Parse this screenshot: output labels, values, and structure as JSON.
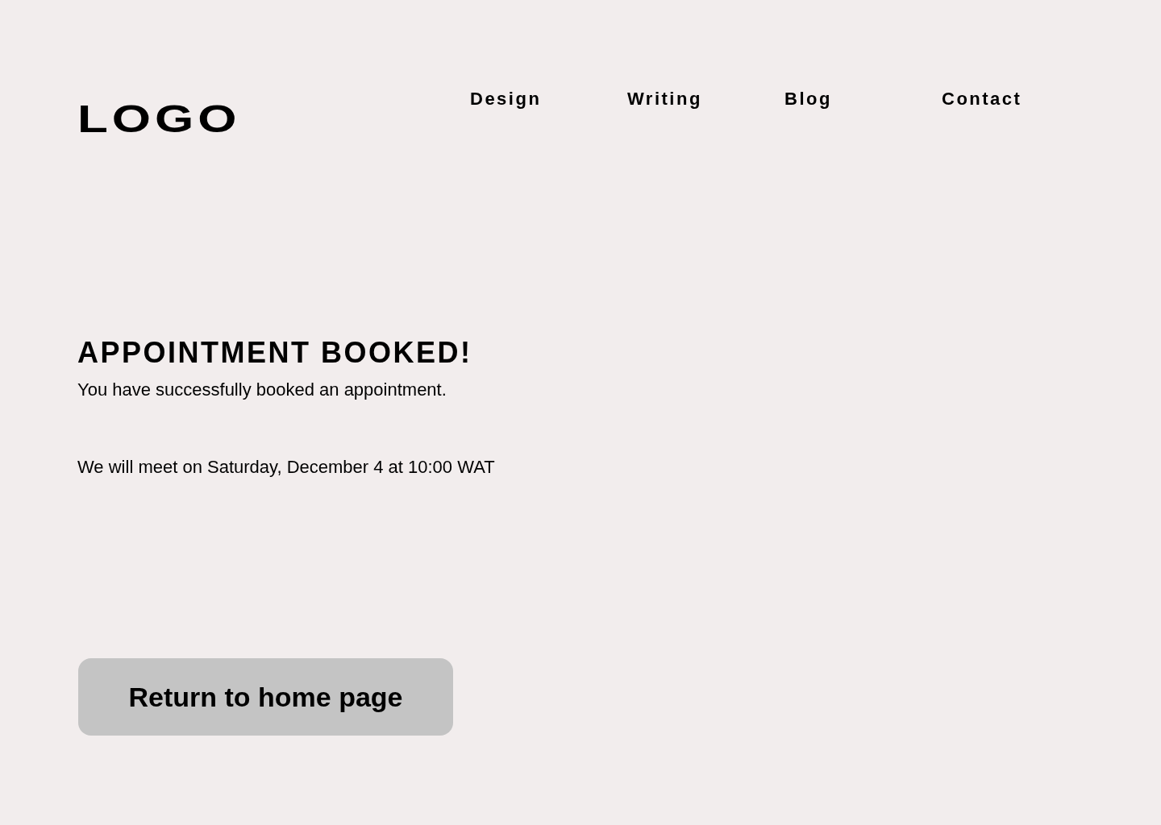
{
  "header": {
    "logo": "LOGO",
    "nav": [
      {
        "label": "Design"
      },
      {
        "label": "Writing"
      },
      {
        "label": "Blog"
      },
      {
        "label": "Contact"
      }
    ]
  },
  "confirmation": {
    "title": "APPOINTMENT BOOKED!",
    "message": "You have successfully booked an appointment.",
    "details": "We will meet on Saturday, December 4 at 10:00 WAT"
  },
  "button": {
    "label": "Return to home page"
  }
}
